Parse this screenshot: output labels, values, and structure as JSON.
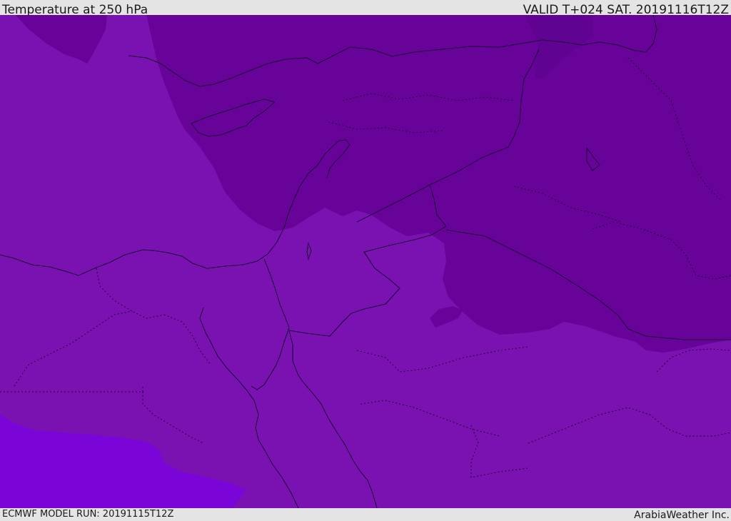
{
  "header": {
    "title": "Temperature at 250 hPa",
    "valid": "VALID T+024 SAT. 20191116T12Z"
  },
  "footer": {
    "model_run": "ECMWF MODEL RUN: 20191115T12Z",
    "credit": "ArabiaWeather Inc."
  },
  "map": {
    "field": "temperature-250hPa",
    "colors": {
      "warm_band": "#7a12b2",
      "cold_band": "#68039a",
      "coldest_band": "#600292",
      "warmest_band": "#7b04d8",
      "border_line": "#1a0033"
    }
  }
}
